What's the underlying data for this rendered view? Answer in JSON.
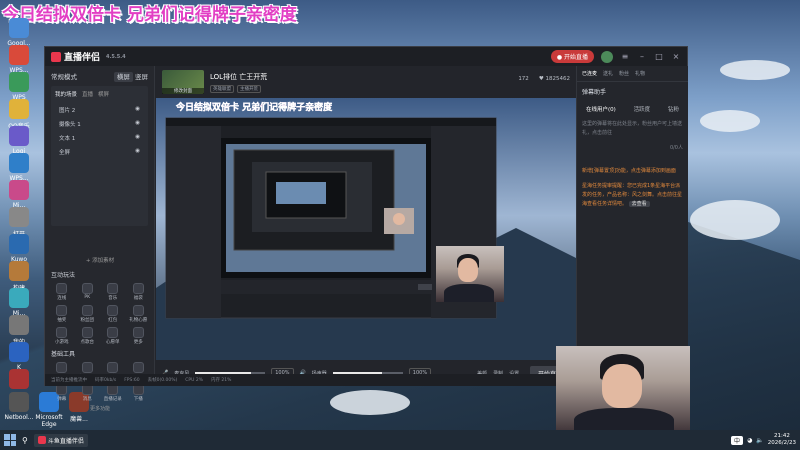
{
  "overlay": {
    "title": "今日结拟双倍卡 兄弟们记得牌子亲密度"
  },
  "desktop": {
    "icons": [
      "Googl...",
      "WPS...",
      "WPS",
      "QQ音乐",
      "Logi",
      "WPS...",
      "Mi...",
      "打开",
      "Kuwo",
      "构建",
      "Mi...",
      "我的",
      "K",
      "魔兽"
    ],
    "bottom_icons": [
      "Netbool...",
      "Microsoft Edge",
      "魔兽..."
    ]
  },
  "app": {
    "logo": "直播伴侣",
    "version": "4.5.5.4",
    "live_button": "● 开始直播",
    "left": {
      "mode_label": "常规模式",
      "mode_tabs": [
        "横屏",
        "竖屏"
      ],
      "scene_label": "我的场景",
      "scene_tabs": [
        "直播",
        "直播",
        "横屏"
      ],
      "sources": [
        {
          "name": "图片 2"
        },
        {
          "name": "摄像头 1"
        },
        {
          "name": "文本 1"
        },
        {
          "name": "全屏"
        }
      ],
      "add_source": "+ 添加素材",
      "interact_title": "互动玩法",
      "interact_tools": [
        "连线",
        "PK",
        "音乐",
        "福袋",
        "抽奖",
        "粉丝团",
        "红包",
        "礼物心愿",
        "小游戏",
        "点歌台",
        "心愿单",
        "更多"
      ],
      "basic_title": "基础工具",
      "basic_tools": [
        "任务中心",
        "直播助手",
        "房管",
        "设置",
        "弹幕",
        "消息",
        "直播记录",
        "下播"
      ],
      "more": "更多功能"
    },
    "center": {
      "cover_label": "修改封面",
      "room_title": "LOL排位 亡王开荒",
      "room_tags": [
        "英雄联盟",
        "主播开荒"
      ],
      "stats": [
        "172",
        "♥ 1825462"
      ],
      "mic_label": "麦克风",
      "mic_pct": "100%",
      "mic_level": 0.8,
      "speaker_label": "扬声器",
      "speaker_pct": "100%",
      "speaker_level": 0.7,
      "ctrl_icons": [
        "美颜",
        "录制",
        "设置"
      ],
      "start_button": "开始直播"
    },
    "right": {
      "tabs": [
        "已连麦",
        "送礼",
        "粉丝",
        "礼物"
      ],
      "helper_title": "弹幕助手",
      "sub_tabs": [
        "在线用户(0)",
        "活跃度",
        "钻粉"
      ],
      "tip_text": "这里的弹幕将在此处显示，粉丝用户可上墙送礼，点击前往",
      "notice_1": "新增[弹幕置顶]功能，点击弹幕添加到画面",
      "notice_2": "星海任务提审提醒：您已完成1条星海平台派发的任务，产品名称：风之剑舞。点击前往星海查看任务详情吧。",
      "join_label": "去查看",
      "counter": "0/0人"
    },
    "status": [
      "当前为主播推流中",
      "码率0kb/s",
      "FPS:60",
      "丢帧0(0.00%)",
      "CPU 2%",
      "内存 21%"
    ]
  },
  "taskbar": {
    "app_label": "斗鱼直播伴侣",
    "time": "21:42",
    "date": "2026/2/23",
    "ime": "中"
  },
  "colors": {
    "accent": "#e9374d",
    "overlay_text": "#e23ec4"
  }
}
